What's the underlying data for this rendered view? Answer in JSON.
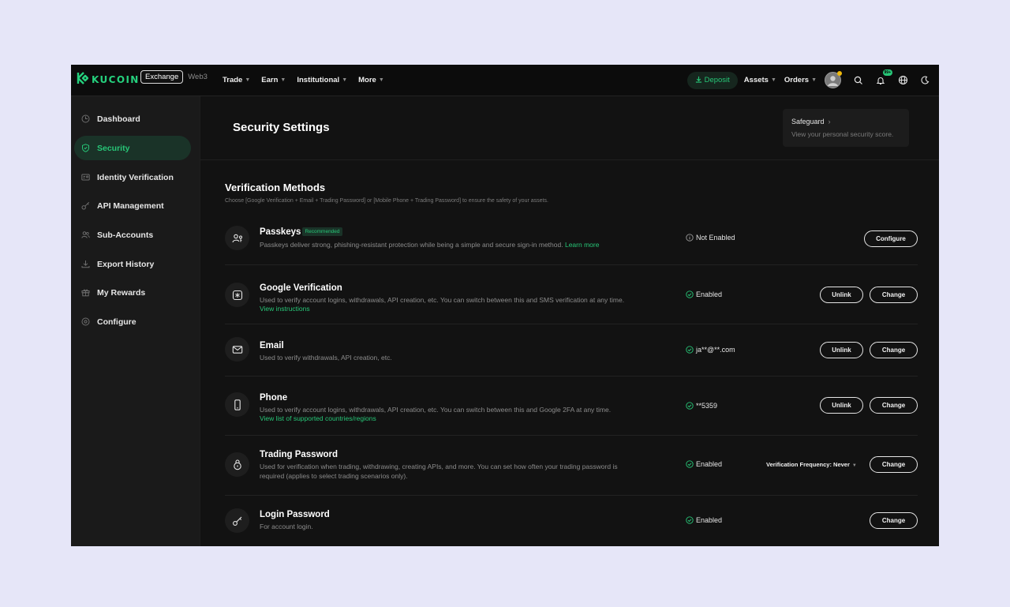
{
  "topnav": {
    "logo_text": "KUCOIN",
    "mode_active": "Exchange",
    "mode_inactive": "Web3",
    "menu": [
      {
        "label": "Trade"
      },
      {
        "label": "Earn"
      },
      {
        "label": "Institutional"
      },
      {
        "label": "More"
      }
    ],
    "deposit_label": "Deposit",
    "assets_label": "Assets",
    "orders_label": "Orders",
    "notif_badge": "99+",
    "accent_color": "#27c677"
  },
  "sidebar": {
    "items": [
      {
        "label": "Dashboard",
        "icon": "clock-icon"
      },
      {
        "label": "Security",
        "icon": "shield-icon",
        "active": true
      },
      {
        "label": "Identity Verification",
        "icon": "id-card-icon"
      },
      {
        "label": "API Management",
        "icon": "key-icon"
      },
      {
        "label": "Sub-Accounts",
        "icon": "users-icon"
      },
      {
        "label": "Export History",
        "icon": "download-icon"
      },
      {
        "label": "My Rewards",
        "icon": "gift-icon"
      },
      {
        "label": "Configure",
        "icon": "settings-icon"
      }
    ]
  },
  "header": {
    "title": "Security Settings",
    "safeguard_title": "Safeguard",
    "safeguard_sub": "View your personal security score."
  },
  "verification": {
    "title": "Verification Methods",
    "subtitle": "Choose [Google Verification + Email + Trading Password] or [Mobile Phone + Trading Password] to ensure the safety of your assets.",
    "rows": [
      {
        "title": "Passkeys",
        "badge": "Recommended",
        "desc": "Passkeys deliver strong, phishing-resistant protection while being a simple and secure sign-in method.",
        "link": "Learn more",
        "status": "Not Enabled",
        "status_icon": "info-icon",
        "buttons": [
          "Configure"
        ]
      },
      {
        "title": "Google Verification",
        "desc": "Used to verify account logins, withdrawals, API creation, etc. You can switch between this and SMS verification at any time.",
        "link": "View instructions",
        "status": "Enabled",
        "status_icon": "check-icon",
        "buttons": [
          "Unlink",
          "Change"
        ]
      },
      {
        "title": "Email",
        "desc": "Used to verify withdrawals, API creation, etc.",
        "status": "ja**@**.com",
        "status_icon": "check-icon",
        "buttons": [
          "Unlink",
          "Change"
        ]
      },
      {
        "title": "Phone",
        "desc": "Used to verify account logins, withdrawals, API creation, etc. You can switch between this and Google 2FA at any time.",
        "link": "View list of supported countries/regions",
        "status": "**5359",
        "status_icon": "check-icon",
        "buttons": [
          "Unlink",
          "Change"
        ]
      },
      {
        "title": "Trading Password",
        "desc_line1": "Used for verification when trading, withdrawing, creating APIs, and more. You can set how often your trading password is",
        "desc_line2": "required (applies to select trading scenarios only).",
        "status": "Enabled",
        "status_icon": "check-icon",
        "frequency": "Verification Frequency: Never",
        "buttons": [
          "Change"
        ]
      },
      {
        "title": "Login Password",
        "desc": "For account login.",
        "status": "Enabled",
        "status_icon": "check-icon",
        "buttons": [
          "Change"
        ]
      }
    ]
  }
}
